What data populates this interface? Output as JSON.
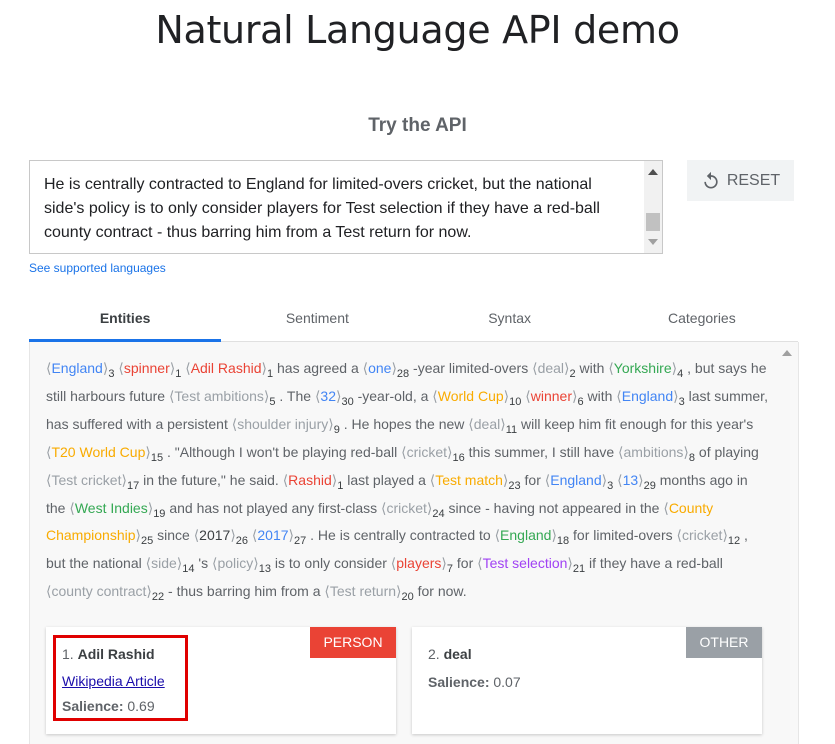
{
  "page": {
    "title": "Natural Language API demo",
    "section_title": "Try the API"
  },
  "input": {
    "text": "He is centrally contracted to England for limited-overs cricket, but the national side's policy is to only consider players for Test selection if they have a red-ball county contract - thus barring him from a Test return for now."
  },
  "reset_button": {
    "label": "RESET",
    "icon": "reset-icon"
  },
  "languages_link": "See supported languages",
  "tabs": [
    {
      "label": "Entities",
      "active": true
    },
    {
      "label": "Sentiment",
      "active": false
    },
    {
      "label": "Syntax",
      "active": false
    },
    {
      "label": "Categories",
      "active": false
    }
  ],
  "colors": {
    "accent": "#1a73e8",
    "person": "#ea4335",
    "location": "#4285f4",
    "organization": "#34a853",
    "event": "#f9ab00",
    "other": "#9aa0a6",
    "consumer_good": "#a142f4"
  },
  "annotated_segments": [
    {
      "e": "England",
      "n": "3",
      "c": "blue"
    },
    {
      "t": " "
    },
    {
      "e": "spinner",
      "n": "1",
      "c": "red"
    },
    {
      "t": " "
    },
    {
      "e": "Adil Rashid",
      "n": "1",
      "c": "red"
    },
    {
      "t": " has agreed a "
    },
    {
      "e": "one",
      "n": "28",
      "c": "blue"
    },
    {
      "t": " -year limited-overs "
    },
    {
      "e": "deal",
      "n": "2",
      "c": "gray"
    },
    {
      "t": " with "
    },
    {
      "e": "Yorkshire",
      "n": "4",
      "c": "green"
    },
    {
      "t": " , but says he still harbours future "
    },
    {
      "e": "Test ambitions",
      "n": "5",
      "c": "gray"
    },
    {
      "t": " . The "
    },
    {
      "e": "32",
      "n": "30",
      "c": "blue"
    },
    {
      "t": " -year-old, a "
    },
    {
      "e": "World Cup",
      "n": "10",
      "c": "orange"
    },
    {
      "t": " "
    },
    {
      "e": "winner",
      "n": "6",
      "c": "red"
    },
    {
      "t": " with "
    },
    {
      "e": "England",
      "n": "3",
      "c": "blue"
    },
    {
      "t": " last summer, has suffered with a persistent "
    },
    {
      "e": "shoulder injury",
      "n": "9",
      "c": "gray"
    },
    {
      "t": " . He hopes the new "
    },
    {
      "e": "deal",
      "n": "11",
      "c": "gray"
    },
    {
      "t": " will keep him fit enough for this year's "
    },
    {
      "e": "T20 World Cup",
      "n": "15",
      "c": "orange"
    },
    {
      "t": " . \"Although I won't be playing red-ball "
    },
    {
      "e": "cricket",
      "n": "16",
      "c": "gray"
    },
    {
      "t": " this summer, I still have "
    },
    {
      "e": "ambitions",
      "n": "8",
      "c": "gray"
    },
    {
      "t": " of playing "
    },
    {
      "e": "Test cricket",
      "n": "17",
      "c": "gray"
    },
    {
      "t": " in the future,\" he said. "
    },
    {
      "e": "Rashid",
      "n": "1",
      "c": "red"
    },
    {
      "t": " last played a "
    },
    {
      "e": "Test match",
      "n": "23",
      "c": "orange"
    },
    {
      "t": " for "
    },
    {
      "e": "England",
      "n": "3",
      "c": "blue"
    },
    {
      "t": " "
    },
    {
      "e": "13",
      "n": "29",
      "c": "blue"
    },
    {
      "t": " months ago in the "
    },
    {
      "e": "West Indies",
      "n": "19",
      "c": "green"
    },
    {
      "t": " and has not played any first-class "
    },
    {
      "e": "cricket",
      "n": "24",
      "c": "gray"
    },
    {
      "t": " since - having not appeared in the "
    },
    {
      "e": "County Championship",
      "n": "25",
      "c": "orange"
    },
    {
      "t": " since "
    },
    {
      "e": "2017",
      "n": "26",
      "c": "dark"
    },
    {
      "t": " "
    },
    {
      "e": "2017",
      "n": "27",
      "c": "blue"
    },
    {
      "t": " . He is centrally contracted to "
    },
    {
      "e": "England",
      "n": "18",
      "c": "green"
    },
    {
      "t": " for limited-overs "
    },
    {
      "e": "cricket",
      "n": "12",
      "c": "gray"
    },
    {
      "t": " , but the national "
    },
    {
      "e": "side",
      "n": "14",
      "c": "gray"
    },
    {
      "t": " 's "
    },
    {
      "e": "policy",
      "n": "13",
      "c": "gray"
    },
    {
      "t": " is to only consider "
    },
    {
      "e": "players",
      "n": "7",
      "c": "red"
    },
    {
      "t": " for "
    },
    {
      "e": "Test selection",
      "n": "21",
      "c": "purple"
    },
    {
      "t": " if they have a red-ball "
    },
    {
      "e": "county contract",
      "n": "22",
      "c": "gray"
    },
    {
      "t": " - thus barring him from a "
    },
    {
      "e": "Test return",
      "n": "20",
      "c": "gray"
    },
    {
      "t": " for now."
    }
  ],
  "entity_cards": [
    {
      "index": "1.",
      "name": "Adil Rashid",
      "type": "PERSON",
      "link": "Wikipedia Article",
      "salience_label": "Salience:",
      "salience": "0.69"
    },
    {
      "index": "2.",
      "name": "deal",
      "type": "OTHER",
      "salience_label": "Salience:",
      "salience": "0.07"
    }
  ]
}
